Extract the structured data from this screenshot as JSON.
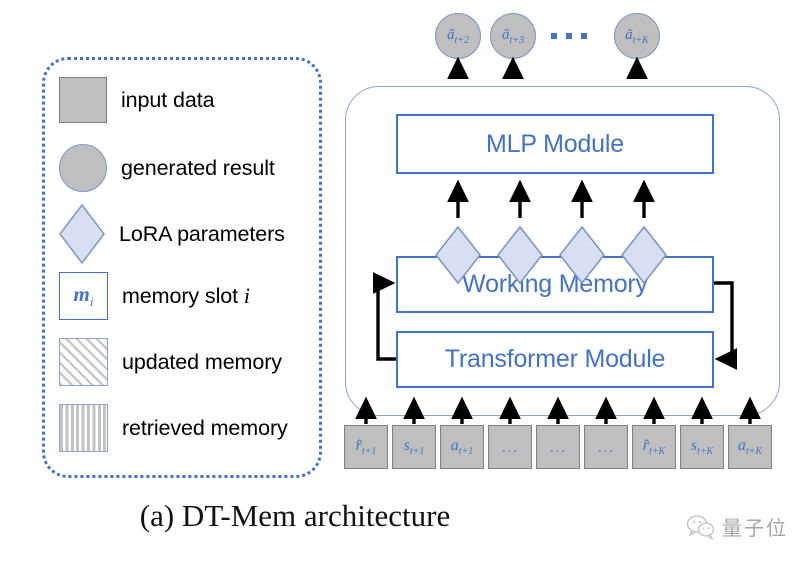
{
  "legend": {
    "items": [
      {
        "shape": "square",
        "label": "input data"
      },
      {
        "shape": "circle",
        "label": "generated result"
      },
      {
        "shape": "diamond",
        "label": "LoRA parameters"
      },
      {
        "shape": "memory-slot",
        "label": "memory slot ",
        "label_italic": "i",
        "box_text": "m",
        "box_sub": "i"
      },
      {
        "shape": "diagonal-hatch",
        "label": "updated memory"
      },
      {
        "shape": "vertical-hatch",
        "label": "retrieved memory"
      }
    ]
  },
  "architecture": {
    "modules": [
      {
        "id": "mlp",
        "label": "MLP Module"
      },
      {
        "id": "working",
        "label": "Working Memory"
      },
      {
        "id": "transformer",
        "label": "Transformer Module"
      }
    ],
    "outputs": [
      {
        "base": "ã",
        "sub": "t+2"
      },
      {
        "base": "ã",
        "sub": "t+3"
      },
      {
        "base": "ã",
        "sub": "t+K"
      }
    ],
    "output_ellipsis": "...",
    "inputs": [
      {
        "base": "r̂",
        "sub": "t+1"
      },
      {
        "base": "s",
        "sub": "t+1"
      },
      {
        "base": "a",
        "sub": "t+1"
      },
      {
        "base": "...",
        "sub": ""
      },
      {
        "base": "...",
        "sub": ""
      },
      {
        "base": "...",
        "sub": ""
      },
      {
        "base": "r̂",
        "sub": "t+K"
      },
      {
        "base": "s",
        "sub": "t+K"
      },
      {
        "base": "a",
        "sub": "t+K"
      }
    ],
    "lora_count": 4
  },
  "caption": "(a) DT-Mem architecture",
  "watermark": {
    "text": "量子位",
    "icon": "wechat-logo-icon"
  },
  "colors": {
    "accent_blue": "#4472c4",
    "light_blue_border": "#8ba4d4",
    "gray_fill": "#bfbfbf",
    "lora_fill": "#d9dff2",
    "gray_border": "#808080"
  }
}
